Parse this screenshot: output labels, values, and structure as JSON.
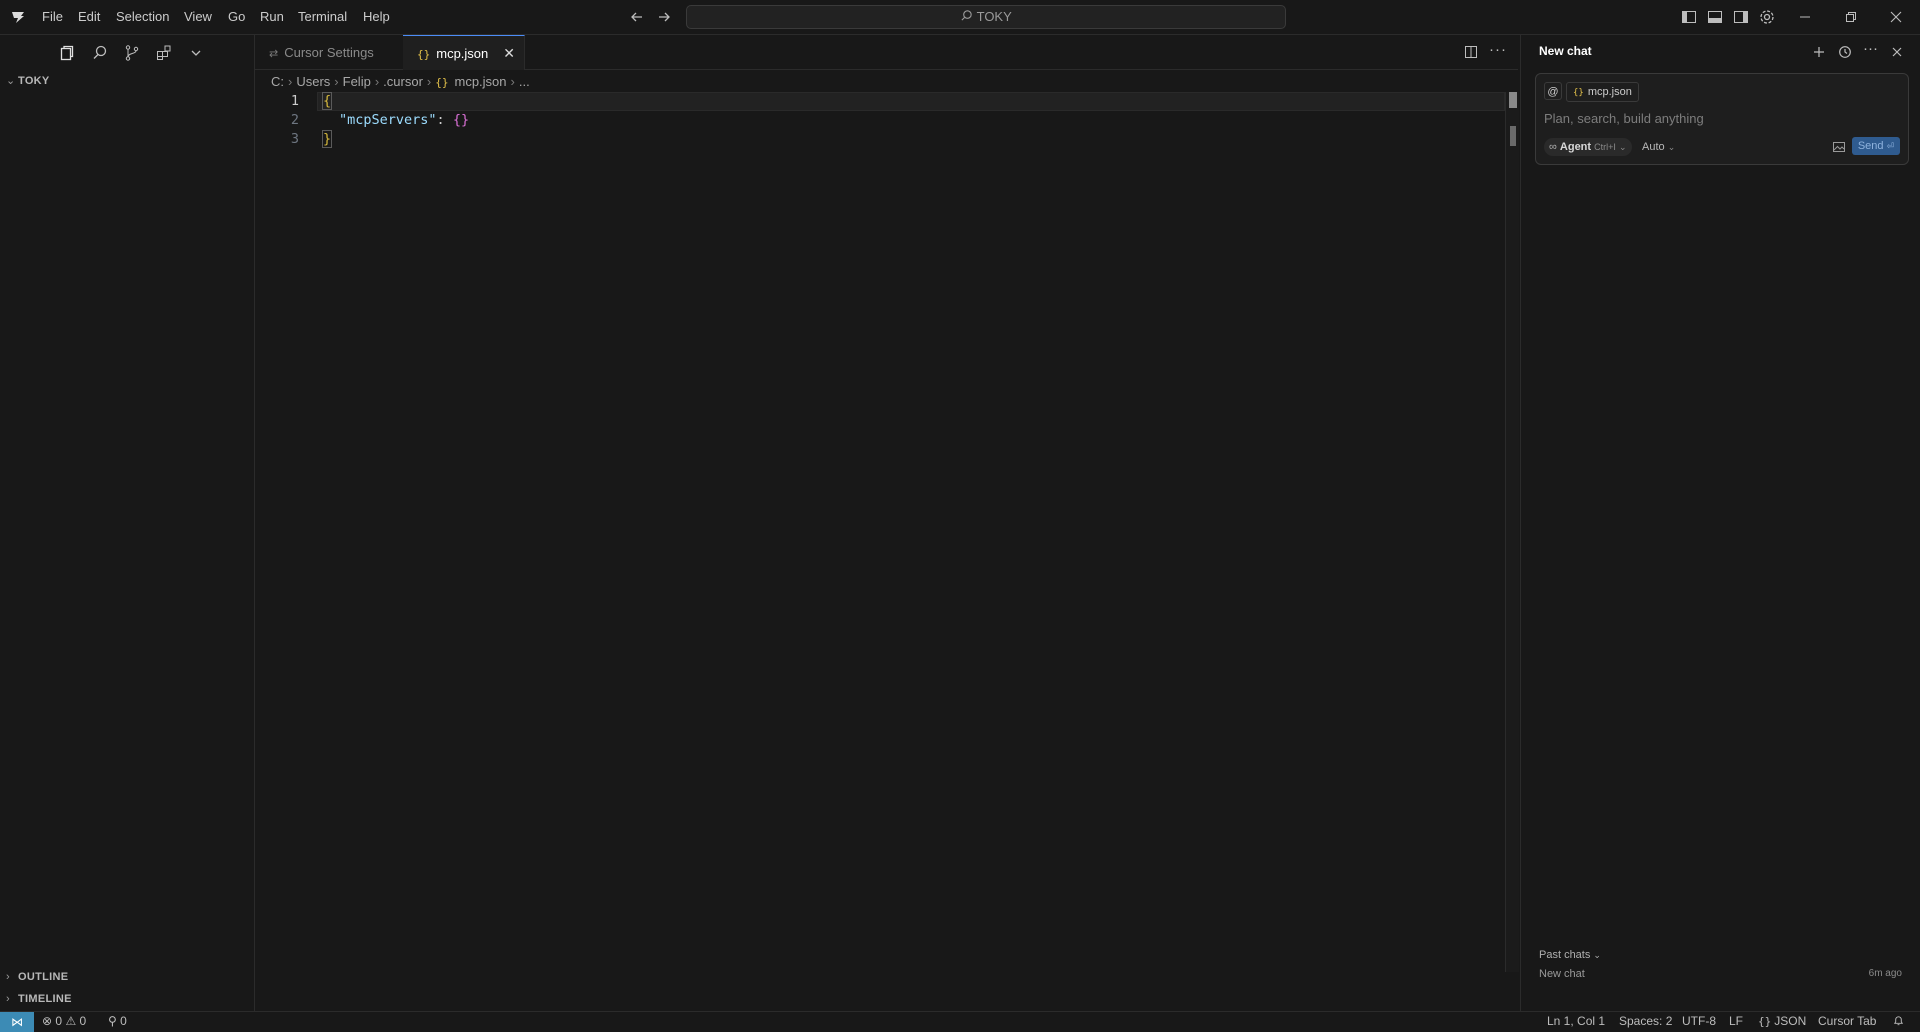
{
  "titlebar": {
    "menu": [
      "File",
      "Edit",
      "Selection",
      "View",
      "Go",
      "Run",
      "Terminal",
      "Help"
    ],
    "search_text": "TOKY"
  },
  "sidebar": {
    "folder": "TOKY",
    "outline_label": "OUTLINE",
    "timeline_label": "TIMELINE"
  },
  "editor": {
    "tabs": [
      {
        "label": "Cursor Settings",
        "active": false
      },
      {
        "label": "mcp.json",
        "active": true
      }
    ],
    "breadcrumb": [
      "C:",
      "Users",
      "Felip",
      ".cursor",
      "mcp.json",
      "..."
    ],
    "lines": [
      {
        "n": "1",
        "text": "{"
      },
      {
        "n": "2",
        "key": "\"mcpServers\"",
        "colon": ": ",
        "value": "{}"
      },
      {
        "n": "3",
        "text": "}"
      }
    ]
  },
  "chat": {
    "title": "New chat",
    "context_chip": "mcp.json",
    "at_symbol": "@",
    "placeholder": "Plan, search, build anything",
    "agent_label": "Agent",
    "agent_shortcut": "Ctrl+I",
    "model": "Auto",
    "send_label": "Send",
    "past_chats_label": "Past chats",
    "past_item_title": "New chat",
    "past_item_time": "6m ago"
  },
  "statusbar": {
    "errors": "0",
    "warnings": "0",
    "ports": "0",
    "position": "Ln 1, Col 1",
    "spaces": "Spaces: 2",
    "encoding": "UTF-8",
    "eol": "LF",
    "language": "JSON",
    "cursor_tab": "Cursor Tab"
  },
  "colors": {
    "background": "#181818",
    "accent": "#4b8cf7",
    "remote": "#3c8bb5",
    "json_key": "#9cdcfe"
  }
}
